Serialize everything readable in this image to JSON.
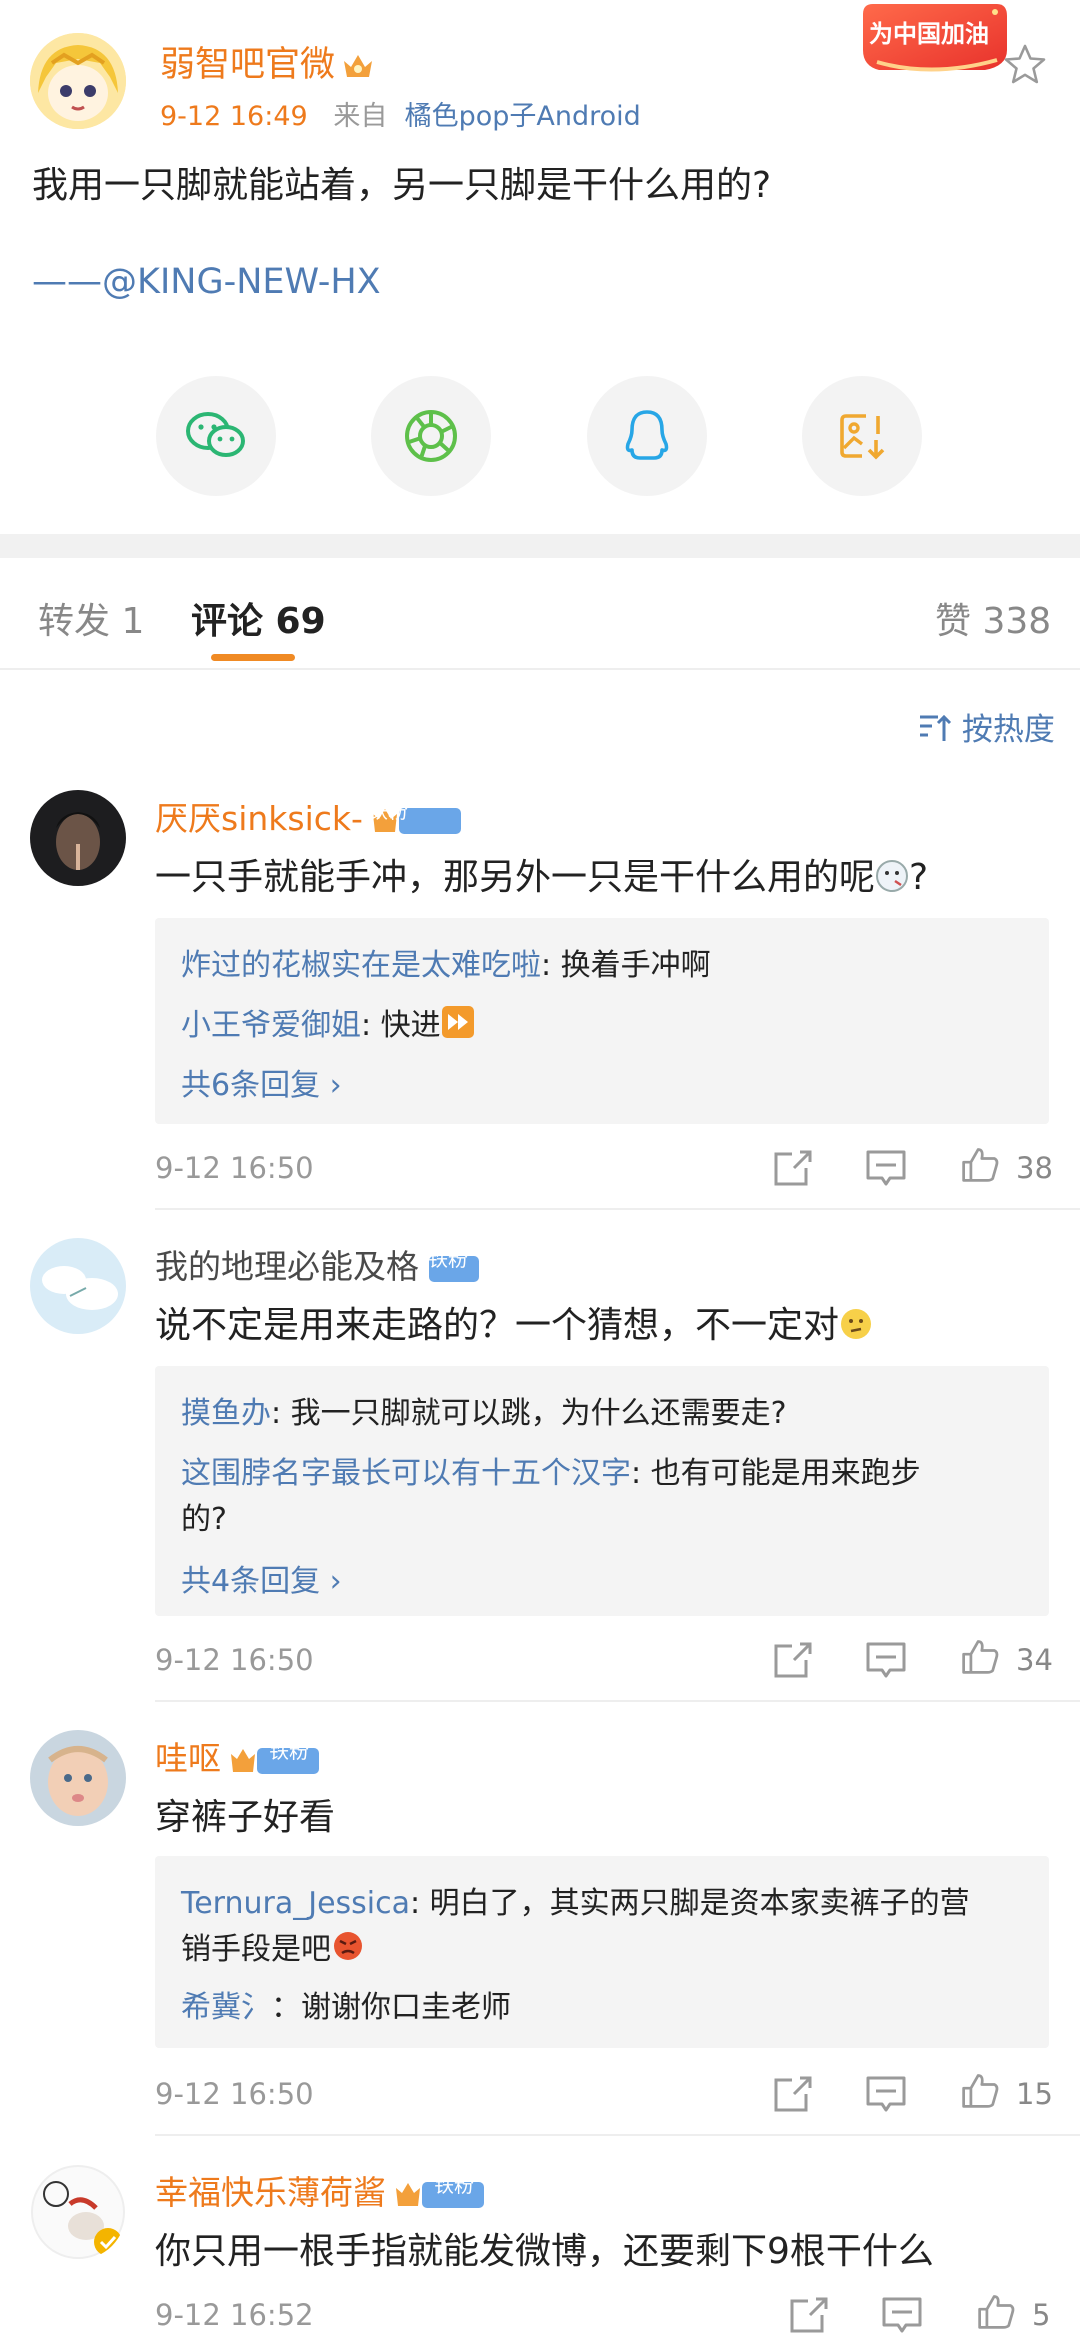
{
  "post": {
    "author": "弱智吧官微",
    "time": "9-12 16:49",
    "source_prefix": "来自",
    "source": "橘色pop子Android",
    "badge": "为中国加油",
    "text": "我用一只脚就能站着，另一只脚是干什么用的?",
    "credit": "——@KING-NEW-HX"
  },
  "share_icons": [
    "wechat-icon",
    "moments-icon",
    "qq-icon",
    "save-image-icon"
  ],
  "tabs": {
    "repost": "转发 1",
    "comments": "评论 69",
    "likes": "赞 338"
  },
  "sort_label": "按热度",
  "fan_badge": "铁粉",
  "comments": [
    {
      "user": "厌厌sinksick-",
      "text": "一只手就能手冲，那另外一只是干什么用的呢",
      "text_suffix": "?",
      "replies": [
        {
          "user": "炸过的花椒实在是太难吃啦",
          "text": ": 换着手冲啊"
        },
        {
          "user": "小王爷爱御姐",
          "text": ": 快进"
        }
      ],
      "more": "共6条回复 ›",
      "time": "9-12 16:50",
      "likes": "38"
    },
    {
      "user": "我的地理必能及格",
      "text": "说不定是用来走路的？一个猜想，不一定对",
      "replies": [
        {
          "user": "摸鱼办",
          "text": ": 我一只脚就可以跳，为什么还需要走?"
        },
        {
          "user": "这围脖名字最长可以有十五个汉字",
          "text": ": 也有可能是用来跑步",
          "text2": "的?"
        }
      ],
      "more": "共4条回复 ›",
      "time": "9-12 16:50",
      "likes": "34"
    },
    {
      "user": "哇呕",
      "text": "穿裤子好看",
      "replies": [
        {
          "user": "Ternura_Jessica",
          "text": ": 明白了，其实两只脚是资本家卖裤子的营",
          "text2": "销手段是吧"
        },
        {
          "user": "希冀氵",
          "text": "：谢谢你口圭老师"
        }
      ],
      "time": "9-12 16:50",
      "likes": "15"
    },
    {
      "user": "幸福快乐薄荷酱",
      "text": "你只用一根手指就能发微博，还要剩下9根干什么",
      "time": "9-12 16:52",
      "likes": "5"
    }
  ],
  "colors": {
    "accent": "#ee7a1c",
    "link": "#4f7bb3",
    "wechat": "#2bb673",
    "moments": "#5ec04a",
    "qq": "#27a6e6",
    "save": "#f0a830"
  }
}
